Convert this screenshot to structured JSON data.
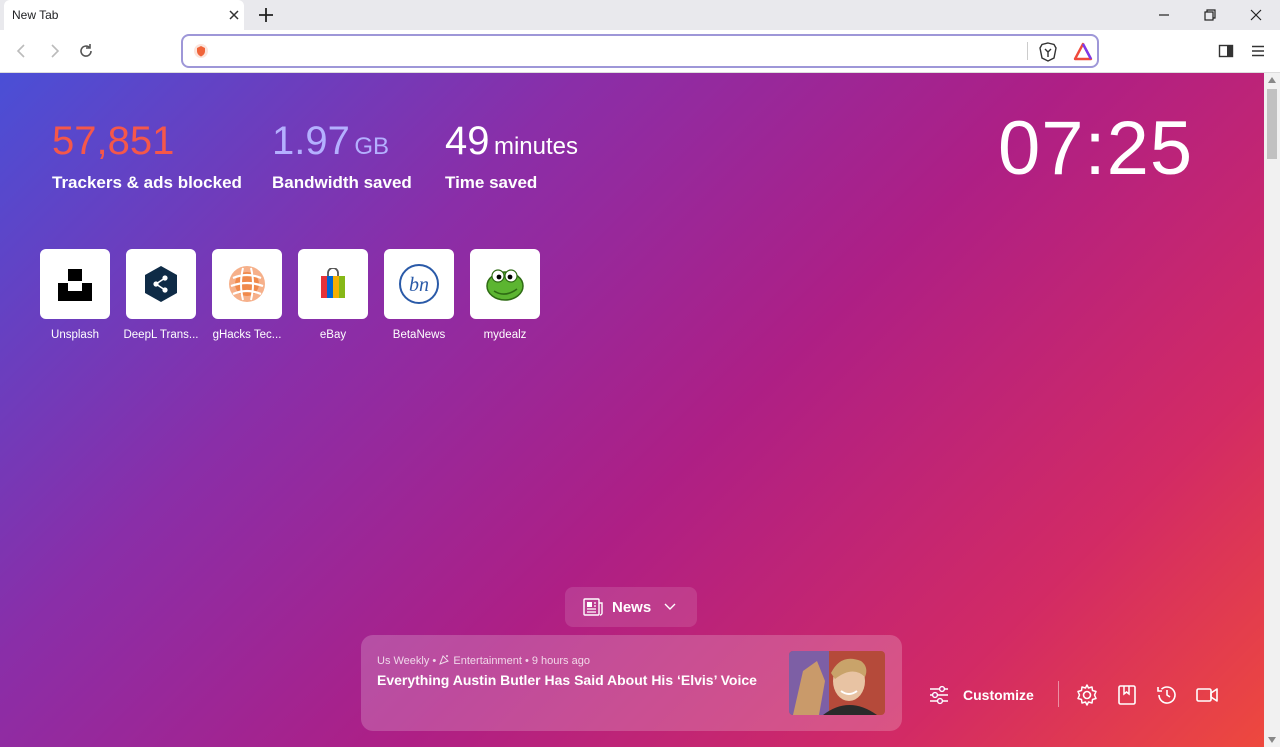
{
  "tab": {
    "title": "New Tab"
  },
  "address_bar": {
    "value": ""
  },
  "stats": [
    {
      "value": "57,851",
      "unit": "",
      "label": "Trackers & ads blocked",
      "color": "#f5574a"
    },
    {
      "value": "1.97",
      "unit": "GB",
      "label": "Bandwidth saved",
      "color": "#b4b0ff"
    },
    {
      "value": "49",
      "unit": "minutes",
      "label": "Time saved",
      "color": "#ffffff"
    }
  ],
  "clock": "07:25",
  "top_sites": [
    {
      "label": "Unsplash",
      "icon": "unsplash-logo"
    },
    {
      "label": "DeepL Trans...",
      "icon": "deepl-logo"
    },
    {
      "label": "gHacks Tec...",
      "icon": "ghacks-logo"
    },
    {
      "label": "eBay",
      "icon": "ebay-bag-logo"
    },
    {
      "label": "BetaNews",
      "icon": "betanews-logo"
    },
    {
      "label": "mydealz",
      "icon": "mydealz-logo"
    }
  ],
  "news_button": {
    "label": "News"
  },
  "news_card": {
    "source": "Us Weekly",
    "category": "Entertainment",
    "age": "9 hours ago",
    "headline": "Everything Austin Butler Has Said About His ‘Elvis’ Voice"
  },
  "customize": {
    "label": "Customize"
  },
  "colors": {
    "accent_orange": "#f5574a",
    "accent_lavender": "#b4b0ff",
    "url_border": "#9e97d8"
  }
}
